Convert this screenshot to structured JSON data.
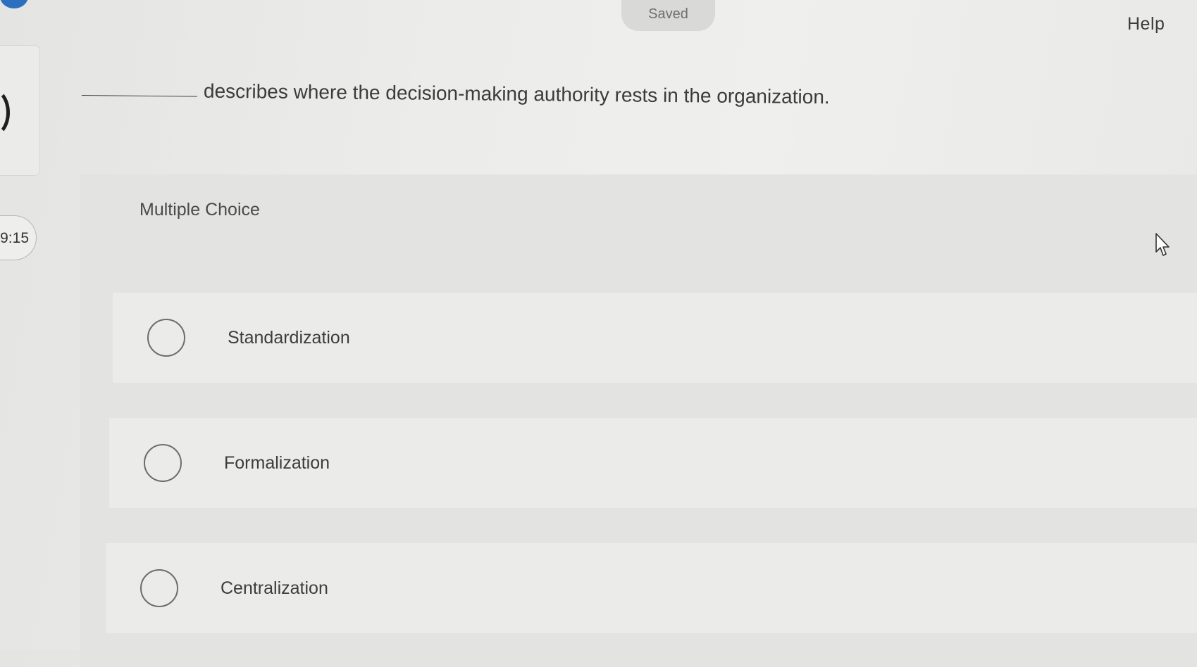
{
  "header": {
    "saved_label": "Saved",
    "help_label": "Help"
  },
  "timer": {
    "text": "9:15"
  },
  "question": {
    "text": "describes where the decision-making authority rests in the organization."
  },
  "choices": {
    "heading": "Multiple Choice",
    "options": [
      {
        "label": "Standardization",
        "selected": false
      },
      {
        "label": "Formalization",
        "selected": false
      },
      {
        "label": "Centralization",
        "selected": false
      }
    ]
  },
  "colors": {
    "background": "#ececea",
    "panel": "#e3e3e1",
    "option_row": "#ebebe9",
    "accent_badge": "#2d6fbf",
    "text": "#3b3b3b"
  },
  "icons": {
    "cursor": "pointer-arrow-icon",
    "radio": "radio-empty-icon"
  }
}
